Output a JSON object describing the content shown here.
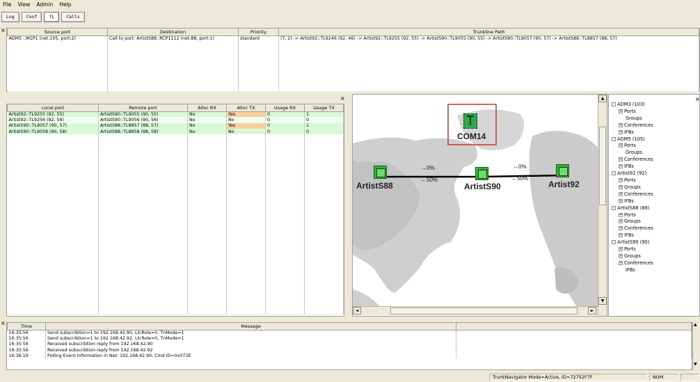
{
  "menu": [
    "File",
    "View",
    "Admin",
    "Help"
  ],
  "toolbar": [
    "Log",
    "Conf",
    "TL",
    "Calls"
  ],
  "calls": {
    "headers": [
      "Source port",
      "Destination",
      "Priority",
      "Trunkline Path"
    ],
    "row": {
      "source": "ADM5  ::M1P1   (net:105, port:2)",
      "destination": "Call to port: ArtistS88::RCP1112 (net:88, port:1)",
      "priority": "standard",
      "path": "(T, 2) -> Artist92::TL9246 (92, 46) -> Artist92::TL9255 (92, 55) -> ArtistS90::TL9055 (90, 55) -> ArtistS90::TL9057 (90, 57) -> ArtistS88::TL8857 (88, 57)"
    }
  },
  "trunklines": {
    "headers": [
      "Local port",
      "Remote port",
      "Alloc RX",
      "Alloc TX",
      "Usage RX",
      "Usage TX"
    ],
    "rows": [
      {
        "local": "Artist92::TL9255 (92, 55)",
        "remote": "ArtistS90::TL9055 (90, 55)",
        "alloc_rx": "No",
        "alloc_tx": "Yes",
        "usage_rx": "0",
        "usage_tx": "1"
      },
      {
        "local": "Artist92::TL9256 (92, 56)",
        "remote": "ArtistS90::TL9056 (90, 56)",
        "alloc_rx": "No",
        "alloc_tx": "No",
        "usage_rx": "0",
        "usage_tx": "0"
      },
      {
        "local": "ArtistS90::TL9057 (90, 57)",
        "remote": "ArtistS88::TL8857 (88, 57)",
        "alloc_rx": "No",
        "alloc_tx": "Yes",
        "usage_rx": "0",
        "usage_tx": "1"
      },
      {
        "local": "ArtistS90::TL9058 (90, 58)",
        "remote": "ArtistS88::TL8858 (88, 58)",
        "alloc_rx": "No",
        "alloc_tx": "No",
        "usage_rx": "0",
        "usage_tx": "0"
      }
    ]
  },
  "map": {
    "com_label": "COM14",
    "nodes": [
      "ArtistS88",
      "ArtistS90",
      "Artist92"
    ],
    "link1": {
      "fwd": "→0%",
      "back": "←50%"
    },
    "link2": {
      "fwd": "→0%",
      "back": "←50%"
    }
  },
  "tree": [
    {
      "label": "ADM3  (103)",
      "children": [
        "Ports",
        "Groups",
        "Conferences",
        "IFBs"
      ]
    },
    {
      "label": "ADM5  (105)",
      "children": [
        "Ports",
        "Groups",
        "Conferences",
        "IFBs"
      ]
    },
    {
      "label": "Artist92 (92)",
      "children": [
        "Ports",
        "Groups",
        "Conferences",
        "IFBs"
      ]
    },
    {
      "label": "ArtistS88 (88)",
      "children": [
        "Ports",
        "Groups",
        "Conferences",
        "IFBs"
      ]
    },
    {
      "label": "ArtistS90 (90)",
      "children": [
        "Ports",
        "Groups",
        "Conferences",
        "IFBs"
      ]
    }
  ],
  "log": {
    "headers": [
      "Time",
      "Message"
    ],
    "rows": [
      {
        "time": "16:35:56",
        "msg": "Send subscribtion=1 to 192.168.42.90, LtcRole=0, TnMode=1"
      },
      {
        "time": "16:35:56",
        "msg": "Send subscribtion=1 to 192.168.42.92, LtcRole=0, TnMode=1"
      },
      {
        "time": "16:35:56",
        "msg": "Received subscribtion reply from 192.168.42.90"
      },
      {
        "time": "16:35:56",
        "msg": "Received subscribtion reply from 192.168.42.92"
      },
      {
        "time": "16:36:19",
        "msg": "Polling Event Information in Net: 192.168.42.90, Cmd ID=0x073E"
      }
    ]
  },
  "status": {
    "mode": "TrunkNavigator Mode=Active, ID=72752F7F",
    "num": "NUM"
  },
  "colors": {
    "allocated": "#f6cf9c",
    "row_green": "#d8f8d8",
    "node": "#35b035",
    "highlight": "#c0392b"
  }
}
